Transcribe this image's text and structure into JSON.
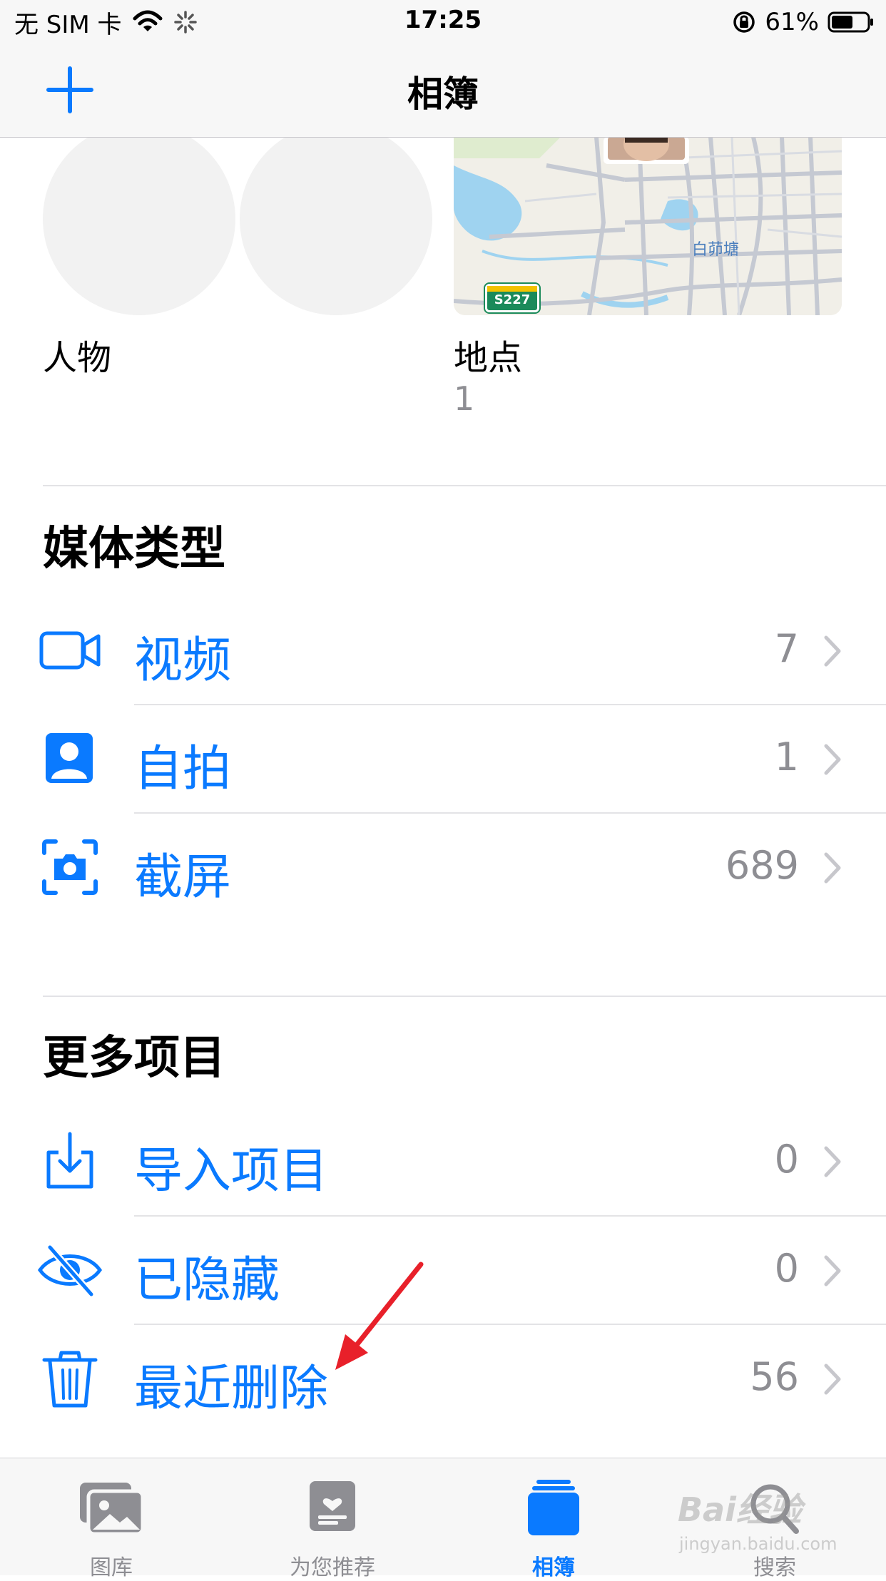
{
  "status_bar": {
    "carrier": "无 SIM 卡",
    "time": "17:25",
    "battery": "61%",
    "battery_level": 0.61
  },
  "nav": {
    "title": "相簿",
    "add_icon": "plus-icon"
  },
  "people": {
    "label": "人物"
  },
  "places": {
    "label": "地点",
    "count": "1",
    "map_place_label": "白茆塘",
    "map_road_sign": "S227"
  },
  "media_types": {
    "title": "媒体类型",
    "items": [
      {
        "label": "视频",
        "count": "7",
        "icon": "video-icon"
      },
      {
        "label": "自拍",
        "count": "1",
        "icon": "selfie-icon"
      },
      {
        "label": "截屏",
        "count": "689",
        "icon": "screenshot-icon"
      }
    ]
  },
  "more_items": {
    "title": "更多项目",
    "items": [
      {
        "label": "导入项目",
        "count": "0",
        "icon": "import-icon"
      },
      {
        "label": "已隐藏",
        "count": "0",
        "icon": "hidden-eye-icon"
      },
      {
        "label": "最近删除",
        "count": "56",
        "icon": "trash-icon"
      }
    ]
  },
  "tabs": [
    {
      "label": "图库",
      "icon": "photos-library-icon",
      "active": false
    },
    {
      "label": "为您推荐",
      "icon": "for-you-icon",
      "active": false
    },
    {
      "label": "相簿",
      "icon": "albums-icon",
      "active": true
    },
    {
      "label": "搜索",
      "icon": "search-icon",
      "active": false
    }
  ],
  "watermark": {
    "text": "Bai经验",
    "sub": "jingyan.baidu.com"
  },
  "colors": {
    "accent": "#0a7aff",
    "secondary_text": "#8e8e93",
    "annotation_arrow": "#e8202a"
  }
}
